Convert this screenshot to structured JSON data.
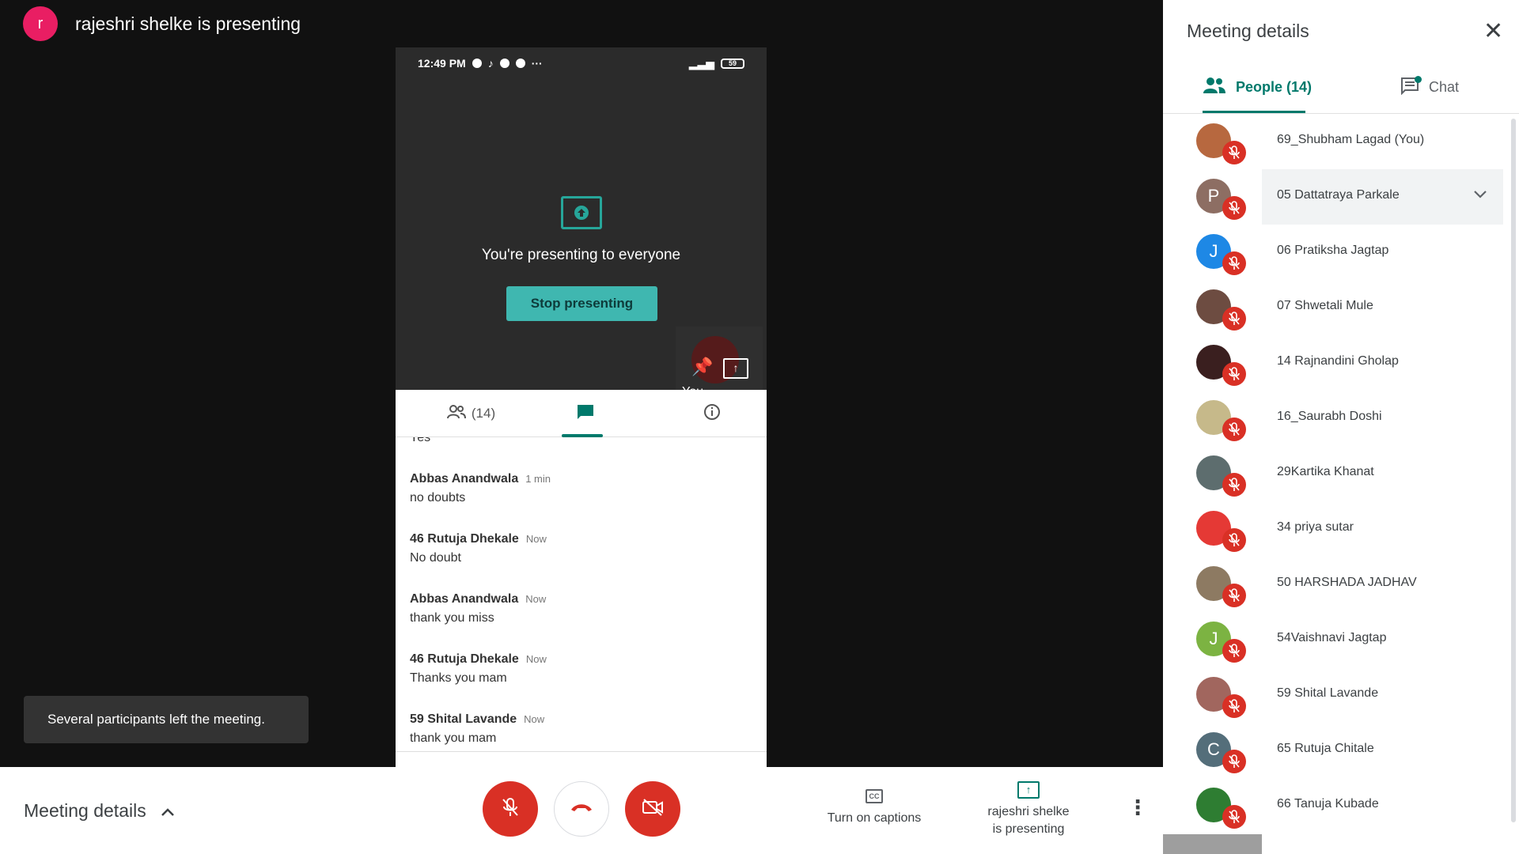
{
  "presenter": {
    "initial": "r",
    "title": "rajeshri shelke is presenting"
  },
  "phone": {
    "time": "12:49 PM",
    "battery": "59",
    "present_message": "You're presenting to everyone",
    "stop_label": "Stop presenting",
    "self_label": "You",
    "tabs": {
      "people_count": "(14)"
    },
    "chat_cut": "Yes",
    "messages": [
      {
        "name": "Abbas Anandwala",
        "time": "1 min",
        "text": "no doubts"
      },
      {
        "name": "46 Rutuja Dhekale",
        "time": "Now",
        "text": "No doubt"
      },
      {
        "name": "Abbas Anandwala",
        "time": "Now",
        "text": "thank you miss"
      },
      {
        "name": "46 Rutuja Dhekale",
        "time": "Now",
        "text": "Thanks you mam"
      },
      {
        "name": "59 Shital Lavande",
        "time": "Now",
        "text": "thank you mam"
      }
    ]
  },
  "toast": "Several participants left the meeting.",
  "bottom": {
    "meeting_details": "Meeting details",
    "captions": "Turn on captions",
    "presenting_line1": "rajeshri shelke",
    "presenting_line2": "is presenting"
  },
  "side": {
    "title": "Meeting details",
    "people_tab": "People (14)",
    "chat_tab": "Chat",
    "people": [
      {
        "name": "69_Shubham Lagad (You)",
        "initial": "",
        "color": "#b7683f"
      },
      {
        "name": "05 Dattatraya Parkale",
        "initial": "P",
        "color": "#8d6e63"
      },
      {
        "name": "06 Pratiksha Jagtap",
        "initial": "J",
        "color": "#1e88e5"
      },
      {
        "name": "07 Shwetali Mule",
        "initial": "",
        "color": "#6d4c41"
      },
      {
        "name": "14 Rajnandini Gholap",
        "initial": "",
        "color": "#3a1f1f"
      },
      {
        "name": "16_Saurabh Doshi",
        "initial": "",
        "color": "#c6b98a"
      },
      {
        "name": "29Kartika Khanat",
        "initial": "",
        "color": "#5d6d6e"
      },
      {
        "name": "34 priya sutar",
        "initial": "",
        "color": "#e53935"
      },
      {
        "name": "50 HARSHADA JADHAV",
        "initial": "",
        "color": "#8d7a62"
      },
      {
        "name": "54Vaishnavi Jagtap",
        "initial": "J",
        "color": "#7cb342"
      },
      {
        "name": "59 Shital Lavande",
        "initial": "",
        "color": "#a1665e"
      },
      {
        "name": "65 Rutuja Chitale",
        "initial": "C",
        "color": "#546e7a"
      },
      {
        "name": "66 Tanuja Kubade",
        "initial": "",
        "color": "#2e7d32"
      }
    ]
  }
}
